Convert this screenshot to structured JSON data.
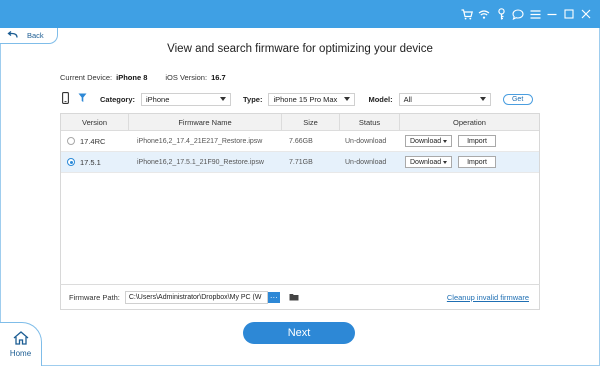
{
  "titlebar": {
    "accent": "#3fa0e4",
    "icons": [
      "cart-icon",
      "wifi-icon",
      "key-icon",
      "feedback-icon",
      "menu-icon",
      "minimize-icon",
      "maximize-icon",
      "close-icon"
    ]
  },
  "nav": {
    "back_label": "Back",
    "home_label": "Home"
  },
  "headline": "View and search firmware for optimizing your device",
  "device": {
    "current_label": "Current Device:",
    "current_value": "iPhone 8",
    "ios_label": "iOS Version:",
    "ios_value": "16.7"
  },
  "filters": {
    "category_label": "Category:",
    "category_value": "iPhone",
    "type_label": "Type:",
    "type_value": "iPhone 15 Pro Max",
    "model_label": "Model:",
    "model_value": "All",
    "get_label": "Get"
  },
  "table": {
    "headers": [
      "Version",
      "Firmware Name",
      "Size",
      "Status",
      "Operation"
    ],
    "rows": [
      {
        "version": "17.4RC",
        "firmware": "iPhone16,2_17.4_21E217_Restore.ipsw",
        "size": "7.66GB",
        "status": "Un-download",
        "download": "Download",
        "import": "Import",
        "selected": false
      },
      {
        "version": "17.5.1",
        "firmware": "iPhone16,2_17.5.1_21F90_Restore.ipsw",
        "size": "7.71GB",
        "status": "Un-download",
        "download": "Download",
        "import": "Import",
        "selected": true
      }
    ]
  },
  "path": {
    "label": "Firmware Path:",
    "value": "C:\\Users\\Administrator\\Dropbox\\My PC (W",
    "browse_label": "···",
    "cleanup_label": "Cleanup invalid firmware"
  },
  "next_label": "Next"
}
